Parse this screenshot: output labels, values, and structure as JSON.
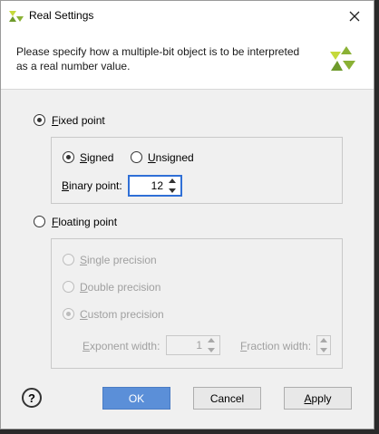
{
  "window": {
    "title": "Real Settings",
    "logo_icon": "xilinx-logo-icon",
    "close_icon": "close-icon"
  },
  "header": {
    "description": "Please specify how a multiple-bit object is to be interpreted as a real number value.",
    "logo_icon": "xilinx-logo-icon"
  },
  "fixed_point": {
    "label_ul": "F",
    "label_rest": "ixed point",
    "selected": true,
    "signed": {
      "label_ul": "S",
      "label_rest": "igned",
      "selected": true
    },
    "unsigned": {
      "label_ul": "U",
      "label_rest": "nsigned",
      "selected": false
    },
    "binary_point": {
      "label_ul": "B",
      "label_rest": "inary point:",
      "value": "12"
    }
  },
  "floating_point": {
    "label_ul": "F",
    "label_rest": "loating point",
    "selected": false,
    "single": {
      "label_ul": "S",
      "label_rest": "ingle precision",
      "selected": false
    },
    "double": {
      "label_ul": "D",
      "label_rest": "ouble precision",
      "selected": false
    },
    "custom": {
      "label_ul": "C",
      "label_rest": "ustom precision",
      "selected": true
    },
    "exponent_width": {
      "label_ul": "E",
      "label_rest": "xponent width:",
      "value": "1"
    },
    "fraction_width": {
      "label_ul": "F",
      "label_rest": "raction width:",
      "value": ""
    }
  },
  "footer": {
    "help_label": "?",
    "ok_label": "OK",
    "cancel_label": "Cancel",
    "apply_ul": "A",
    "apply_rest": "pply"
  },
  "colors": {
    "accent": "#5b8fd8",
    "logo": "#8ab135",
    "focus": "#2f6fd6"
  }
}
